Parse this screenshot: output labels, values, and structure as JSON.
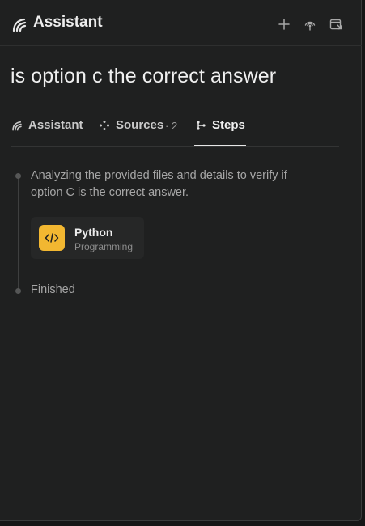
{
  "header": {
    "title": "Assistant",
    "icons": [
      "assistant-logo-icon",
      "plus-icon",
      "broadcast-icon",
      "open-window-icon"
    ]
  },
  "query": "is option c the correct answer",
  "tabs": [
    {
      "label": "Assistant",
      "icon": "assistant-logo-icon",
      "active": false
    },
    {
      "label": "Sources",
      "count": "· 2",
      "icon": "sources-icon",
      "active": false
    },
    {
      "label": "Steps",
      "icon": "steps-icon",
      "active": true
    }
  ],
  "steps": {
    "analyzing": "Analyzing the provided files and details to verify if option C is the correct answer.",
    "tool": {
      "name": "Python",
      "category": "Programming",
      "icon": "code-icon",
      "color": "#f2b731"
    },
    "finished": "Finished"
  },
  "colors": {
    "background": "#1f2020",
    "accent_yellow": "#f2b731",
    "text_primary": "#f0f0f0",
    "text_muted": "#a6a6a6"
  }
}
